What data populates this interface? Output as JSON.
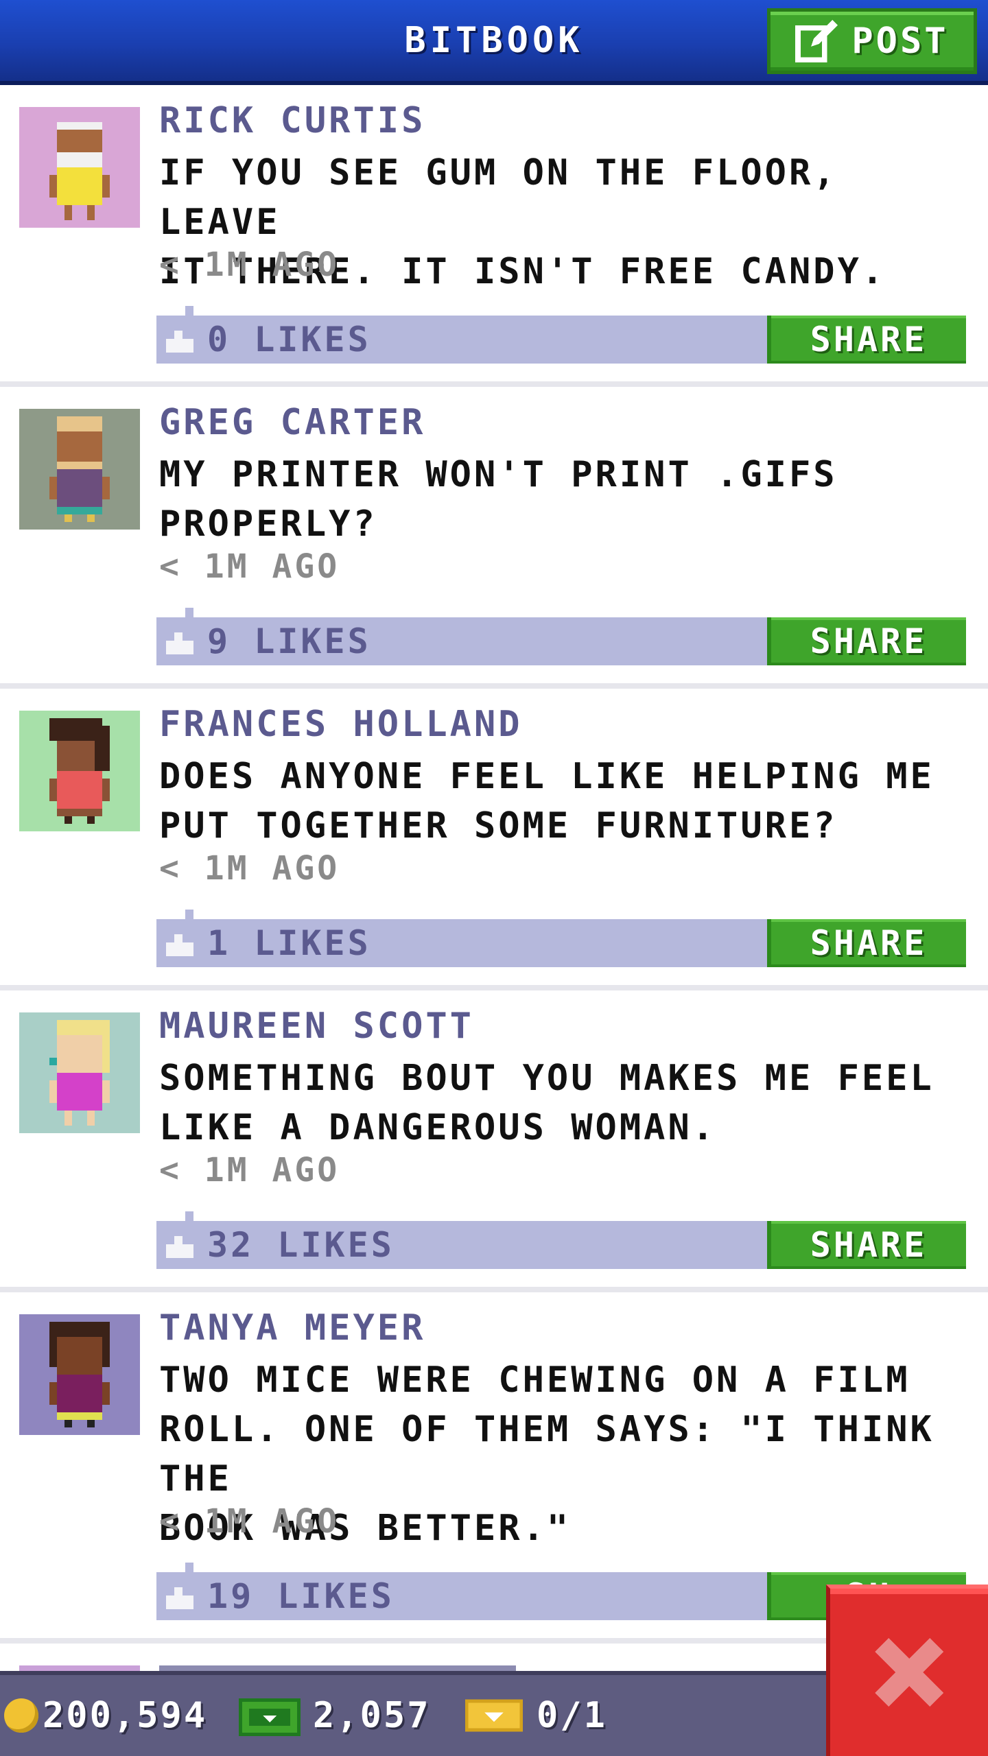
{
  "header": {
    "title": "BITBOOK",
    "post_label": "POST"
  },
  "posts": [
    {
      "author": "RICK CURTIS",
      "message": "IF YOU SEE GUM ON THE FLOOR, LEAVE\nIT THERE. IT ISN'T FREE CANDY.",
      "time": "< 1M AGO",
      "likes": "0 LIKES",
      "share_label": "SHARE",
      "avatar_bg": "#d9a6d6"
    },
    {
      "author": "GREG CARTER",
      "message": "MY PRINTER WON'T PRINT .GIFS\nPROPERLY?",
      "time": "< 1M AGO",
      "likes": "9 LIKES",
      "share_label": "SHARE",
      "avatar_bg": "#8e9a88"
    },
    {
      "author": "FRANCES HOLLAND",
      "message": "DOES ANYONE FEEL LIKE HELPING ME\nPUT TOGETHER SOME FURNITURE?",
      "time": "< 1M AGO",
      "likes": "1 LIKES",
      "share_label": "SHARE",
      "avatar_bg": "#a7e0a9"
    },
    {
      "author": "MAUREEN SCOTT",
      "message": "SOMETHING BOUT YOU MAKES ME FEEL\nLIKE A DANGEROUS WOMAN.",
      "time": "< 1M AGO",
      "likes": "32 LIKES",
      "share_label": "SHARE",
      "avatar_bg": "#a9cfc7"
    },
    {
      "author": "TANYA MEYER",
      "message": "TWO MICE WERE CHEWING ON A FILM\nROLL. ONE OF THEM SAYS: \"I THINK THE\nBOOK WAS BETTER.\"",
      "time": "< 1M AGO",
      "likes": "19 LIKES",
      "share_label": "SH",
      "avatar_bg": "#8f86bf"
    }
  ],
  "status": {
    "coins": "200,594",
    "bux": "2,057",
    "tickets": "0/1"
  },
  "colors": {
    "header": "#1a3fb0",
    "accent_green": "#3fa52b",
    "like_bar": "#b5b8dc",
    "author_text": "#5b5a8f",
    "bottom_bar": "#5e5c80",
    "close_red": "#e02d2d"
  },
  "icons": {
    "post": "edit-icon",
    "like": "thumbs-up-icon",
    "coin": "coin-icon",
    "bux": "bux-bill-icon",
    "ticket": "golden-ticket-icon",
    "close": "close-icon"
  }
}
